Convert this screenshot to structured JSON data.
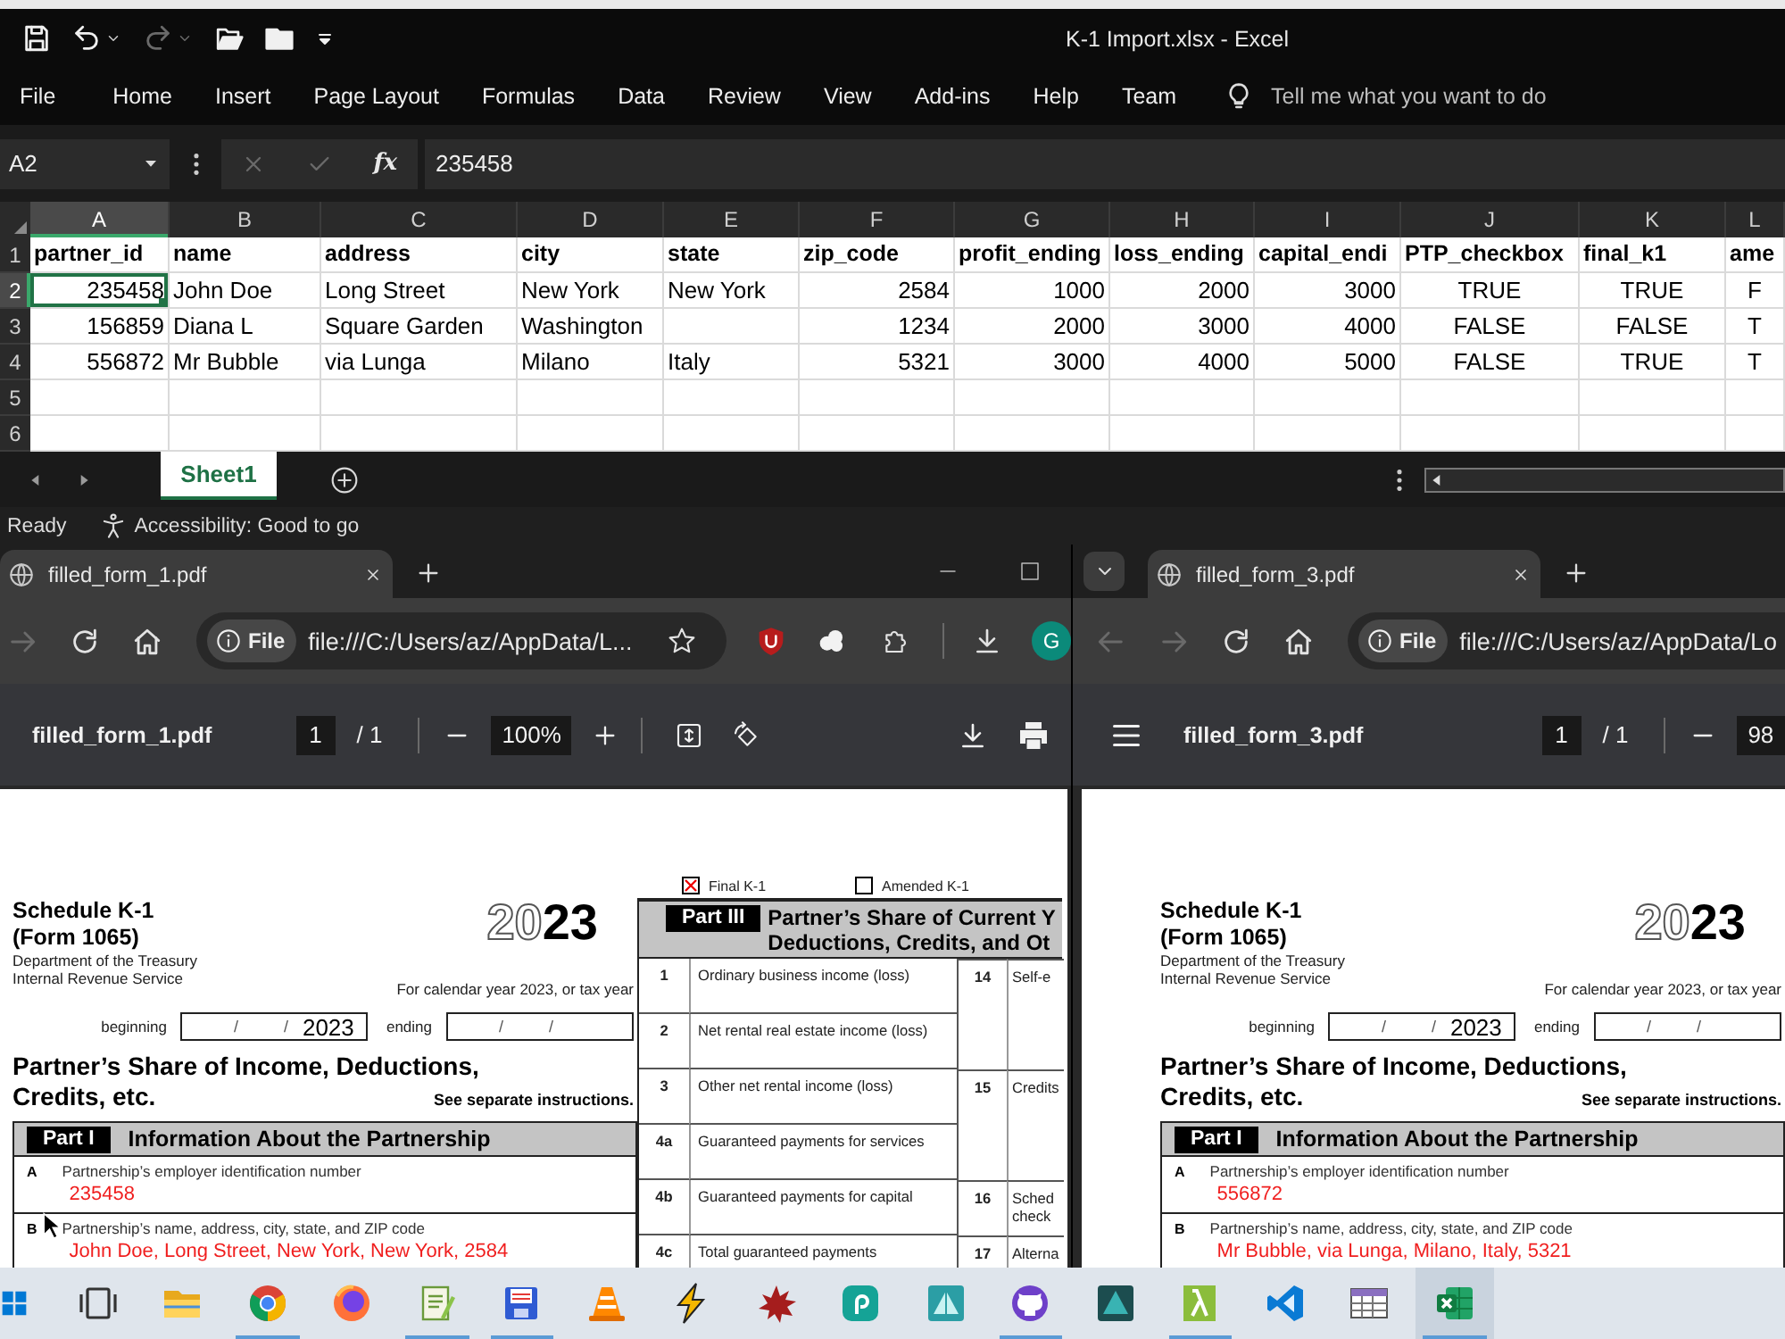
{
  "excel": {
    "quick_access": [
      {
        "kind": "save",
        "disabled": false
      },
      {
        "kind": "undo",
        "disabled": false
      },
      {
        "kind": "redo",
        "disabled": true
      },
      {
        "kind": "open",
        "disabled": false
      },
      {
        "kind": "folder",
        "disabled": false
      },
      {
        "kind": "customize",
        "disabled": false
      }
    ],
    "title": "K-1 Import.xlsx - Excel",
    "ribbon_tabs": [
      "File",
      "Home",
      "Insert",
      "Page Layout",
      "Formulas",
      "Data",
      "Review",
      "View",
      "Add-ins",
      "Help",
      "Team"
    ],
    "tell_me": {
      "placeholder": "Tell me what you want to do"
    },
    "name_box": "A2",
    "formula_buttons": [
      {
        "kind": "cancel",
        "disabled": true
      },
      {
        "kind": "enter",
        "disabled": true
      },
      {
        "kind": "function",
        "disabled": false,
        "label": "fx"
      }
    ],
    "formula": "235458",
    "grid": {
      "columns": [
        {
          "label": "A",
          "kind": "number",
          "selected": true
        },
        {
          "label": "B",
          "kind": "text",
          "selected": false
        },
        {
          "label": "C",
          "kind": "text",
          "selected": false
        },
        {
          "label": "D",
          "kind": "text",
          "selected": false
        },
        {
          "label": "E",
          "kind": "text",
          "selected": false
        },
        {
          "label": "F",
          "kind": "number",
          "selected": false
        },
        {
          "label": "G",
          "kind": "number",
          "selected": false
        },
        {
          "label": "H",
          "kind": "number",
          "selected": false
        },
        {
          "label": "I",
          "kind": "number",
          "selected": false
        },
        {
          "label": "J",
          "kind": "boolean",
          "selected": false
        },
        {
          "label": "K",
          "kind": "boolean",
          "selected": false
        },
        {
          "label": "L",
          "kind": "boolean",
          "selected": false
        }
      ],
      "rows": [
        {
          "label": "1",
          "kind": "header",
          "selected": false,
          "cells": [
            "partner_id",
            "name",
            "address",
            "city",
            "state",
            "zip_code",
            "profit_ending",
            "loss_ending",
            "capital_endi",
            "PTP_checkbox",
            "final_k1",
            "ame"
          ]
        },
        {
          "label": "2",
          "kind": "data",
          "selected": true,
          "cells": [
            "235458",
            "John Doe",
            "Long Street",
            "New York",
            "New York",
            "2584",
            "1000",
            "2000",
            "3000",
            "TRUE",
            "TRUE",
            "F"
          ]
        },
        {
          "label": "3",
          "kind": "data",
          "selected": false,
          "cells": [
            "156859",
            "Diana L",
            "Square Garden",
            "Washington",
            null,
            "1234",
            "2000",
            "3000",
            "4000",
            "FALSE",
            "FALSE",
            "T"
          ]
        },
        {
          "label": "4",
          "kind": "data",
          "selected": false,
          "cells": [
            "556872",
            "Mr Bubble",
            "via Lunga",
            "Milano",
            "Italy",
            "5321",
            "3000",
            "4000",
            "5000",
            "FALSE",
            "TRUE",
            "T"
          ]
        },
        {
          "label": "5",
          "kind": "data",
          "selected": false
        },
        {
          "label": "6",
          "kind": "data",
          "selected": false
        }
      ]
    },
    "sheets": [
      {
        "label": "Sheet1",
        "selected": true
      }
    ],
    "status": {
      "mode": "Ready",
      "accessibility": "Accessibility: Good to go"
    }
  },
  "browsers": [
    {
      "kind": "left",
      "tabs": [
        {
          "title": "filled_form_1.pdf",
          "selected": true
        }
      ],
      "nav": [
        {
          "kind": "forward",
          "disabled": true
        },
        {
          "kind": "reload",
          "disabled": false
        },
        {
          "kind": "home",
          "disabled": false
        }
      ],
      "address": {
        "chip": "File",
        "url": "file:///C:/Users/az/AppData/L..."
      },
      "profile": "G",
      "viewer": {
        "file": "filled_form_1.pdf",
        "page": "1",
        "total": "/ 1",
        "zoom": "100%"
      },
      "form": {
        "schedule": "Schedule K-1",
        "form_number": "(Form 1065)",
        "agency": [
          "Department of the Treasury",
          "Internal Revenue Service"
        ],
        "year": "20**23**",
        "period_note": "For calendar year 2023, or tax year",
        "period": [
          {
            "label": "beginning",
            "parts": [
              "/",
              "/",
              "2023"
            ]
          },
          {
            "label": "ending",
            "parts": [
              "/",
              "/"
            ]
          }
        ],
        "heading": [
          "Partner’s Share of Income, Deductions,",
          "Credits, etc."
        ],
        "instructions": "See separate instructions.",
        "checkboxes": [
          {
            "label": "Final K-1",
            "checked": true
          },
          {
            "label": "Amended K-1",
            "checked": false
          }
        ],
        "part_i": {
          "tag": "Part I",
          "title": "Information About the Partnership",
          "items": [
            {
              "letter": "A",
              "label": "Partnership’s employer identification number",
              "value": "235458"
            },
            {
              "letter": "B",
              "label": "Partnership’s name, address, city, state, and ZIP code",
              "value": "John Doe, Long Street, New York, New York, 2584"
            }
          ]
        },
        "part_iii": {
          "tag": "Part III",
          "title": [
            "Partner’s Share of Current Y",
            "Deductions, Credits, and Ot"
          ],
          "rows": [
            {
              "number": "1",
              "label": "Ordinary business income (loss)",
              "side_number": "14",
              "side_label": "Self-e"
            },
            {
              "number": "2",
              "label": "Net rental real estate income (loss)"
            },
            {
              "number": "3",
              "label": "Other net rental income (loss)",
              "side_number": "15",
              "side_label": "Credits"
            },
            {
              "number": "4a",
              "label": "Guaranteed payments for services"
            },
            {
              "number": "4b",
              "label": "Guaranteed payments for capital",
              "side_number": "16",
              "side_label": "Sched check"
            },
            {
              "number": "4c",
              "label": "Total guaranteed payments",
              "side_number": "17",
              "side_label": "Alterna"
            }
          ]
        }
      }
    },
    {
      "kind": "right",
      "tabs": [
        {
          "title": "filled_form_3.pdf",
          "selected": true
        }
      ],
      "nav": [
        {
          "kind": "back",
          "disabled": true
        },
        {
          "kind": "forward",
          "disabled": true
        },
        {
          "kind": "reload",
          "disabled": false
        },
        {
          "kind": "home",
          "disabled": false
        }
      ],
      "address": {
        "chip": "File",
        "url": "file:///C:/Users/az/AppData/Lo"
      },
      "viewer": {
        "file": "filled_form_3.pdf",
        "page": "1",
        "total": "/ 1",
        "zoom": "98"
      },
      "form": {
        "schedule": "Schedule K-1",
        "form_number": "(Form 1065)",
        "agency": [
          "Department of the Treasury",
          "Internal Revenue Service"
        ],
        "year": "20**23**",
        "period_note": "For calendar year 2023, or tax year",
        "period": [
          {
            "label": "beginning",
            "parts": [
              "/",
              "/",
              "2023"
            ]
          },
          {
            "label": "ending",
            "parts": [
              "/",
              "/"
            ]
          }
        ],
        "heading": [
          "Partner’s Share of Income, Deductions,",
          "Credits, etc."
        ],
        "instructions": "See separate instructions.",
        "part_i": {
          "tag": "Part I",
          "title": "Information About the Partnership",
          "items": [
            {
              "letter": "A",
              "label": "Partnership’s employer identification number",
              "value": "556872"
            },
            {
              "letter": "B",
              "label": "Partnership’s name, address, city, state, and ZIP code",
              "value": "Mr Bubble, via Lunga, Milano, Italy, 5321"
            }
          ]
        }
      }
    }
  ],
  "taskbar": [
    {
      "kind": "start",
      "running": false,
      "selected": false
    },
    {
      "kind": "taskview",
      "running": false,
      "selected": false
    },
    {
      "kind": "explorer",
      "running": false,
      "selected": false
    },
    {
      "kind": "chrome",
      "running": true,
      "selected": false
    },
    {
      "kind": "firefox",
      "running": false,
      "selected": false
    },
    {
      "kind": "notepad",
      "running": true,
      "selected": false
    },
    {
      "kind": "floppy",
      "running": true,
      "selected": false
    },
    {
      "kind": "vlc",
      "running": false,
      "selected": false
    },
    {
      "kind": "winamp",
      "running": false,
      "selected": false
    },
    {
      "kind": "splat",
      "running": false,
      "selected": false
    },
    {
      "kind": "spiral",
      "running": false,
      "selected": false
    },
    {
      "kind": "pyramid",
      "running": false,
      "selected": false
    },
    {
      "kind": "github",
      "running": true,
      "selected": false
    },
    {
      "kind": "tower",
      "running": false,
      "selected": false
    },
    {
      "kind": "lambda",
      "running": true,
      "selected": false
    },
    {
      "kind": "vscode",
      "running": false,
      "selected": false
    },
    {
      "kind": "table",
      "running": false,
      "selected": false
    },
    {
      "kind": "excel",
      "running": true,
      "selected": true
    }
  ]
}
